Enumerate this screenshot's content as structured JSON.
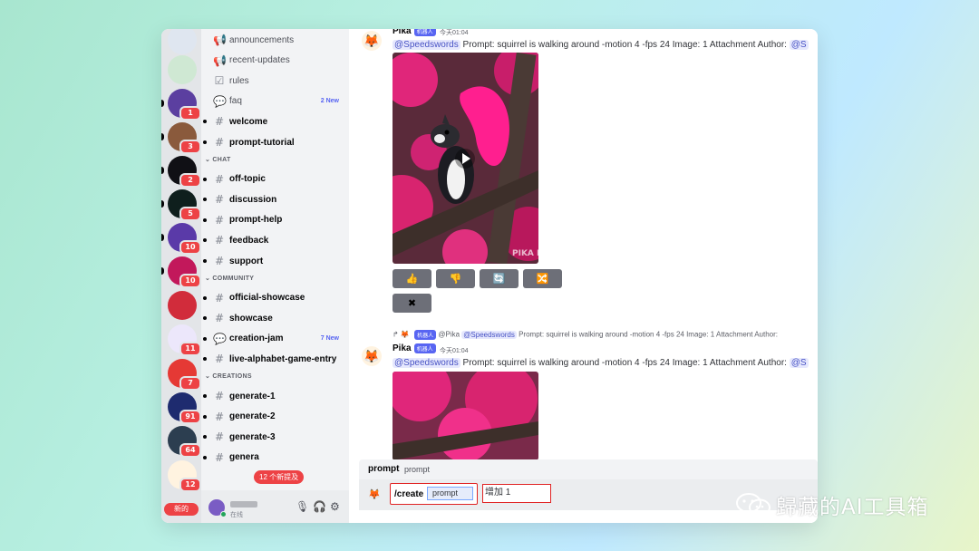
{
  "rail": {
    "servers": [
      {
        "icon": "sailboat-icon",
        "color": "#dfe6f0",
        "badge": ""
      },
      {
        "icon": "green-bot-icon",
        "color": "#cfe8d3",
        "badge": ""
      },
      {
        "icon": "number-one-icon",
        "color": "#5b3fa0",
        "badge": "1"
      },
      {
        "icon": "person-avatar-icon",
        "color": "#8a5a3c",
        "badge": "3"
      },
      {
        "icon": "pink-loop-icon",
        "color": "#101015",
        "badge": "2"
      },
      {
        "icon": "r-logo-icon",
        "color": "#0f1f1d",
        "badge": "5"
      },
      {
        "icon": "llama-icon",
        "color": "#5a3aa8",
        "badge": "10"
      },
      {
        "icon": "frame-logo-icon",
        "color": "#c2185b",
        "badge": "10"
      },
      {
        "icon": "robot-eye-icon",
        "color": "#d12c3b",
        "badge": ""
      },
      {
        "icon": "purple-lotus-icon",
        "color": "#ece7fb",
        "badge": "11"
      },
      {
        "icon": "teeth-icon",
        "color": "#e53935",
        "badge": "7"
      },
      {
        "icon": "colorful-text-icon",
        "color": "#1e2b6f",
        "badge": "91"
      },
      {
        "icon": "astronaut-icon",
        "color": "#2c3e50",
        "badge": "64"
      },
      {
        "icon": "pika-fox-icon",
        "color": "#fff3e0",
        "badge": "12"
      }
    ],
    "new_pill": "新的"
  },
  "channels": {
    "items": [
      {
        "icon": "megaphone-icon",
        "glyph": "📢",
        "name": "announcements",
        "bold": false,
        "dot": false,
        "new": ""
      },
      {
        "icon": "megaphone-icon",
        "glyph": "📢",
        "name": "recent-updates",
        "bold": false,
        "dot": false,
        "new": ""
      },
      {
        "icon": "checkbox-icon",
        "glyph": "☑",
        "name": "rules",
        "bold": false,
        "dot": false,
        "new": ""
      },
      {
        "icon": "forum-icon",
        "glyph": "💬",
        "name": "faq",
        "bold": false,
        "dot": false,
        "new": "2 New"
      },
      {
        "icon": "hash-icon",
        "glyph": "#",
        "name": "welcome",
        "bold": true,
        "dot": true,
        "new": ""
      },
      {
        "icon": "hash-icon",
        "glyph": "#",
        "name": "prompt-tutorial",
        "bold": true,
        "dot": true,
        "new": ""
      },
      {
        "category": "CHAT"
      },
      {
        "icon": "hash-icon",
        "glyph": "#",
        "name": "off-topic",
        "bold": true,
        "dot": true,
        "new": ""
      },
      {
        "icon": "hash-thread-icon",
        "glyph": "#",
        "name": "discussion",
        "bold": true,
        "dot": true,
        "new": ""
      },
      {
        "icon": "hash-icon",
        "glyph": "#",
        "name": "prompt-help",
        "bold": true,
        "dot": true,
        "new": ""
      },
      {
        "icon": "hash-icon",
        "glyph": "#",
        "name": "feedback",
        "bold": true,
        "dot": true,
        "new": ""
      },
      {
        "icon": "hash-icon",
        "glyph": "#",
        "name": "support",
        "bold": true,
        "dot": true,
        "new": ""
      },
      {
        "category": "COMMUNITY"
      },
      {
        "icon": "hash-thread-icon",
        "glyph": "#",
        "name": "official-showcase",
        "bold": true,
        "dot": true,
        "new": ""
      },
      {
        "icon": "hash-thread-icon",
        "glyph": "#",
        "name": "showcase",
        "bold": true,
        "dot": true,
        "new": ""
      },
      {
        "icon": "forum-icon",
        "glyph": "💬",
        "name": "creation-jam",
        "bold": true,
        "dot": true,
        "new": "7 New"
      },
      {
        "icon": "hash-icon",
        "glyph": "#",
        "name": "live-alphabet-game-entry",
        "bold": true,
        "dot": true,
        "new": ""
      },
      {
        "category": "CREATIONS"
      },
      {
        "icon": "hash-icon",
        "glyph": "#",
        "name": "generate-1",
        "bold": true,
        "dot": true,
        "new": ""
      },
      {
        "icon": "hash-icon",
        "glyph": "#",
        "name": "generate-2",
        "bold": true,
        "dot": true,
        "new": ""
      },
      {
        "icon": "hash-icon",
        "glyph": "#",
        "name": "generate-3",
        "bold": true,
        "dot": true,
        "new": ""
      },
      {
        "icon": "hash-icon",
        "glyph": "#",
        "name": "genera",
        "bold": true,
        "dot": true,
        "new": ""
      }
    ],
    "new_banner": "12 个新提及"
  },
  "user": {
    "status": "在线"
  },
  "chat": {
    "msg1": {
      "author": "Pika",
      "bot_tag": "机器人",
      "time": "今天01:04",
      "mention": "@Speedswords",
      "text": " Prompt: squirrel is walking around -motion 4 -fps 24  Image: 1 Attachment  Author: ",
      "tail_mention": "@S",
      "watermark": "PIKA LABS"
    },
    "reactions": [
      {
        "icon": "thumbs-up-icon",
        "glyph": "👍"
      },
      {
        "icon": "thumbs-down-icon",
        "glyph": "👎"
      },
      {
        "icon": "refresh-icon",
        "glyph": "🔄"
      },
      {
        "icon": "shuffle-icon",
        "glyph": "🔀"
      },
      {
        "icon": "delete-x-icon",
        "glyph": "✖"
      }
    ],
    "reply": {
      "bot_tag": "机器人",
      "author_mention": "@Pika",
      "mention": "@Speedswords",
      "text": " Prompt: squirrel is walking around -motion 4 -fps 24 Image: 1 Attachment Author: "
    },
    "msg2": {
      "author": "Pika",
      "bot_tag": "机器人",
      "time": "今天01:04",
      "mention": "@Speedswords",
      "text": " Prompt: squirrel is walking around -motion 4 -fps 24  Image: 1 Attachment  Author: ",
      "tail_mention": "@S"
    }
  },
  "composer": {
    "option_name": "prompt",
    "option_desc": "prompt",
    "command": "/create",
    "chip": "prompt",
    "value": "增加 1"
  },
  "watermark": {
    "text": "歸藏的AI工具箱",
    "icon": "wechat-icon"
  }
}
